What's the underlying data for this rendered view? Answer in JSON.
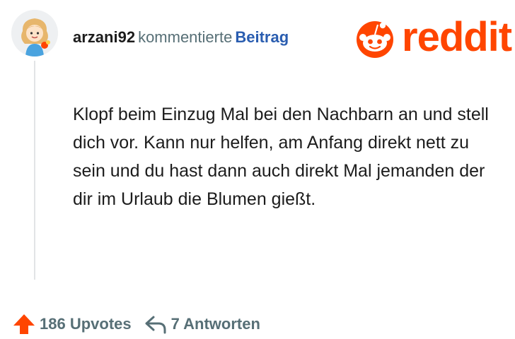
{
  "comment": {
    "username": "arzani92",
    "action": "kommentierte",
    "post_link": "Beitrag",
    "body": "Klopf beim Einzug Mal bei den Nachbarn an und stell dich vor. Kann nur helfen, am Anfang direkt nett zu sein und du hast dann auch direkt Mal jemanden der dir im Urlaub die Blumen gießt.",
    "avatar": "avatar-icon"
  },
  "brand": {
    "logo_text": "reddit",
    "logo_icon": "reddit-alien-icon",
    "color": "#ff4500"
  },
  "footer": {
    "upvotes_label": "186 Upvotes",
    "upvote_icon": "upvote-arrow-icon",
    "upvote_color": "#ff4500",
    "replies_label": "7 Antworten",
    "reply_icon": "reply-arrow-icon"
  }
}
